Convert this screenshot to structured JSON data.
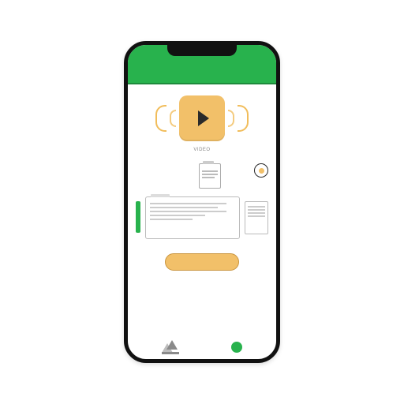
{
  "colors": {
    "brand_green": "#28b24d",
    "accent_amber": "#f2c069",
    "ink": "#2a2a2a"
  },
  "header": {
    "status_time": "",
    "left_label": "",
    "right_label": ""
  },
  "video": {
    "caption": "VIDEO"
  },
  "meta": {
    "line1": "",
    "line2": "",
    "line3": ""
  },
  "action_button": {
    "label": ""
  },
  "icons": {
    "play": "play-icon",
    "record": "record-icon",
    "doc": "document-icon",
    "gallery": "image-icon",
    "status_dot": "status-dot"
  }
}
